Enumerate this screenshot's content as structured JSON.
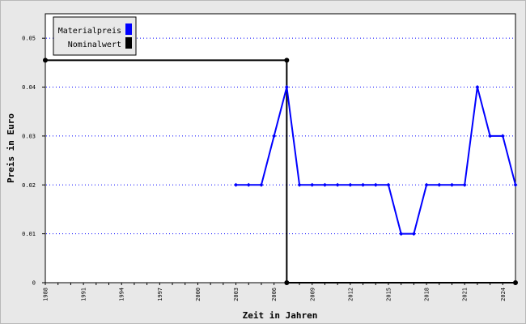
{
  "chart_data": {
    "type": "line",
    "xlabel": "Zeit in Jahren",
    "ylabel": "Preis in Euro",
    "xlim": [
      1988,
      2025
    ],
    "ylim": [
      0,
      0.055
    ],
    "x_ticks": [
      "1988",
      "1991",
      "1994",
      "1997",
      "2000",
      "2003",
      "2006",
      "2009",
      "2012",
      "2015",
      "2018",
      "2021",
      "2024"
    ],
    "y_ticks": [
      "0",
      "0.01",
      "0.02",
      "0.03",
      "0.04",
      "0.05"
    ],
    "grid": "horizontal dotted",
    "legend_position": "top-left",
    "series": [
      {
        "name": "Materialpreis",
        "color": "#0000ff",
        "x": [
          2003,
          2004,
          2005,
          2006,
          2007,
          2008,
          2009,
          2010,
          2011,
          2012,
          2013,
          2014,
          2015,
          2016,
          2017,
          2018,
          2019,
          2020,
          2021,
          2022,
          2023,
          2024,
          2025
        ],
        "y": [
          0.02,
          0.02,
          0.02,
          0.03,
          0.04,
          0.02,
          0.02,
          0.02,
          0.02,
          0.02,
          0.02,
          0.02,
          0.02,
          0.01,
          0.01,
          0.02,
          0.02,
          0.02,
          0.02,
          0.04,
          0.03,
          0.03,
          0.02
        ]
      },
      {
        "name": "Nominalwert",
        "color": "#000000",
        "x": [
          1988,
          2007,
          2007,
          2025
        ],
        "y": [
          0.0455,
          0.0455,
          0,
          0
        ]
      }
    ]
  }
}
